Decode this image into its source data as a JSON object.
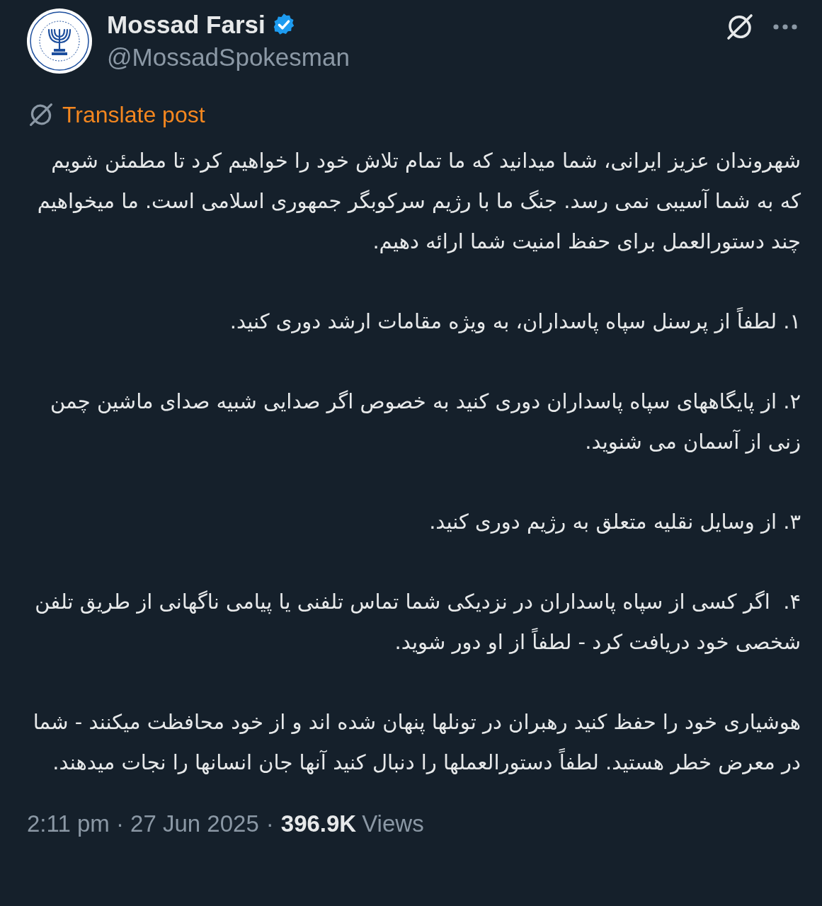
{
  "author": {
    "name": "Mossad Farsi",
    "handle": "@MossadSpokesman",
    "verified": true
  },
  "translate_link": {
    "label": "Translate post"
  },
  "post": {
    "paragraphs": [
      "شهروندان عزیز ایرانی، شما میدانید که ما تمام تلاش خود را خواهیم کرد تا مطمئن شویم که به شما آسیبی نمی رسد. جنگ ما با رژیم سرکوبگر جمهوری اسلامی است. ما میخواهیم چند دستورالعمل برای حفظ امنیت شما ارائه دهیم.",
      "۱. لطفاً از پرسنل سپاه پاسداران، به ویژه مقامات ارشد دوری کنید.",
      "۲. از پایگاههای سپاه پاسداران دوری کنید به خصوص اگر صدایی شبیه صدای ماشین چمن زنی از آسمان می شنوید.",
      "۳. از وسایل نقلیه متعلق به رژیم دوری کنید.",
      "۴.  اگر کسی از سپاه پاسداران در نزدیکی شما تماس تلفنی یا پیامی ناگهانی از طریق تلفن شخصی خود دریافت کرد - لطفاً از او دور شوید.",
      "هوشیاری خود را حفظ کنید رهبران در تونلها پنهان شده اند و از خود محافظت میکنند - شما در معرض خطر هستید. لطفاً دستورالعملها را دنبال کنید آنها جان انسانها را نجات میدهند."
    ]
  },
  "meta": {
    "timestamp": "2:11 pm · 27 Jun 2025",
    "separator": "·",
    "views_count": "396.9K",
    "views_label": "Views"
  }
}
